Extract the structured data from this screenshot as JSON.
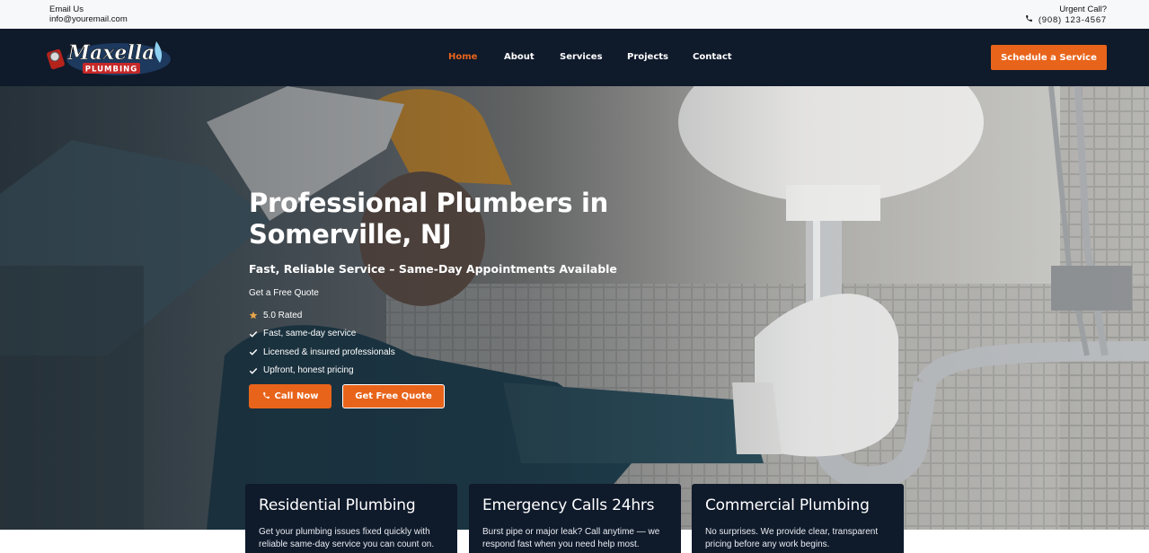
{
  "topbar": {
    "email_label": "Email Us",
    "email": "info@youremail.com",
    "urgent_label": "Urgent Call?",
    "phone": "(908) 123-4567"
  },
  "nav": {
    "logo_text": "Maxella",
    "logo_subtext": "PLUMBING",
    "items": [
      {
        "label": "Home",
        "active": true
      },
      {
        "label": "About"
      },
      {
        "label": "Services"
      },
      {
        "label": "Projects"
      },
      {
        "label": "Contact"
      }
    ],
    "cta_label": "Schedule a Service"
  },
  "hero": {
    "title": "Professional Plumbers in Somerville, NJ",
    "subtitle": "Fast, Reliable Service – Same-Day Appointments Available",
    "quote_label": "Get a Free Quote",
    "features": [
      {
        "icon": "star-icon",
        "text": "5.0 Rated"
      },
      {
        "icon": "check-icon",
        "text": "Fast, same-day service"
      },
      {
        "icon": "check-icon",
        "text": "Licensed & insured professionals"
      },
      {
        "icon": "check-icon",
        "text": "Upfront, honest pricing"
      }
    ],
    "call_button": "Call Now",
    "quote_button": "Get Free Quote"
  },
  "cards": [
    {
      "title": "Residential Plumbing",
      "text": "Get your plumbing issues fixed quickly with reliable same-day service you can count on."
    },
    {
      "title": "Emergency Calls 24hrs",
      "text": "Burst pipe or major leak? Call anytime — we respond fast when you need help most."
    },
    {
      "title": "Commercial Plumbing",
      "text": "No surprises. We provide clear, transparent pricing before any work begins."
    }
  ],
  "colors": {
    "accent": "#e8641b",
    "navy": "#0f1a2b",
    "star": "#e8a54b"
  }
}
